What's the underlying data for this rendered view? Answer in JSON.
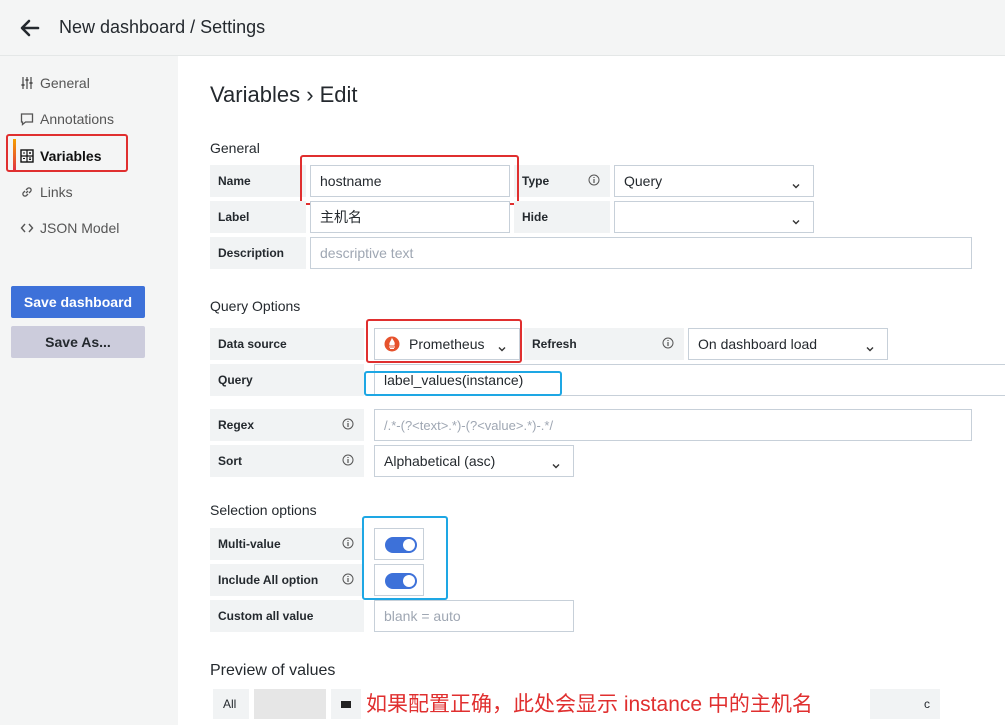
{
  "header": {
    "title": "New dashboard / Settings"
  },
  "sidebar": {
    "items": [
      {
        "label": "General",
        "icon": "sliders-icon"
      },
      {
        "label": "Annotations",
        "icon": "comment-icon"
      },
      {
        "label": "Variables",
        "icon": "calculator-icon"
      },
      {
        "label": "Links",
        "icon": "link-icon"
      },
      {
        "label": "JSON Model",
        "icon": "code-icon"
      }
    ],
    "save_dashboard": "Save dashboard",
    "save_as": "Save As..."
  },
  "page": {
    "title": "Variables › Edit"
  },
  "general": {
    "heading": "General",
    "name_label": "Name",
    "name_value": "hostname",
    "type_label": "Type",
    "type_value": "Query",
    "label_label": "Label",
    "label_value": "主机名",
    "hide_label": "Hide",
    "hide_value": "",
    "description_label": "Description",
    "description_placeholder": "descriptive text"
  },
  "query_options": {
    "heading": "Query Options",
    "datasource_label": "Data source",
    "datasource_value": "Prometheus",
    "refresh_label": "Refresh",
    "refresh_value": "On dashboard load",
    "query_label": "Query",
    "query_value": "label_values(instance)",
    "regex_label": "Regex",
    "regex_placeholder": "/.*-(?<text>.*)-(?<value>.*)-.*/",
    "sort_label": "Sort",
    "sort_value": "Alphabetical (asc)"
  },
  "selection_options": {
    "heading": "Selection options",
    "multi_value_label": "Multi-value",
    "multi_value_on": true,
    "include_all_label": "Include All option",
    "include_all_on": true,
    "custom_all_label": "Custom all value",
    "custom_all_placeholder": "blank = auto"
  },
  "preview": {
    "heading": "Preview of values",
    "first_value": "All",
    "last_value_fragment": "c"
  },
  "annotation_note": "如果配置正确，此处会显示 instance 中的主机名",
  "colors": {
    "primary": "#3d71d9",
    "annotation_red": "#e02f2f",
    "annotation_blue": "#1ea7e4"
  }
}
